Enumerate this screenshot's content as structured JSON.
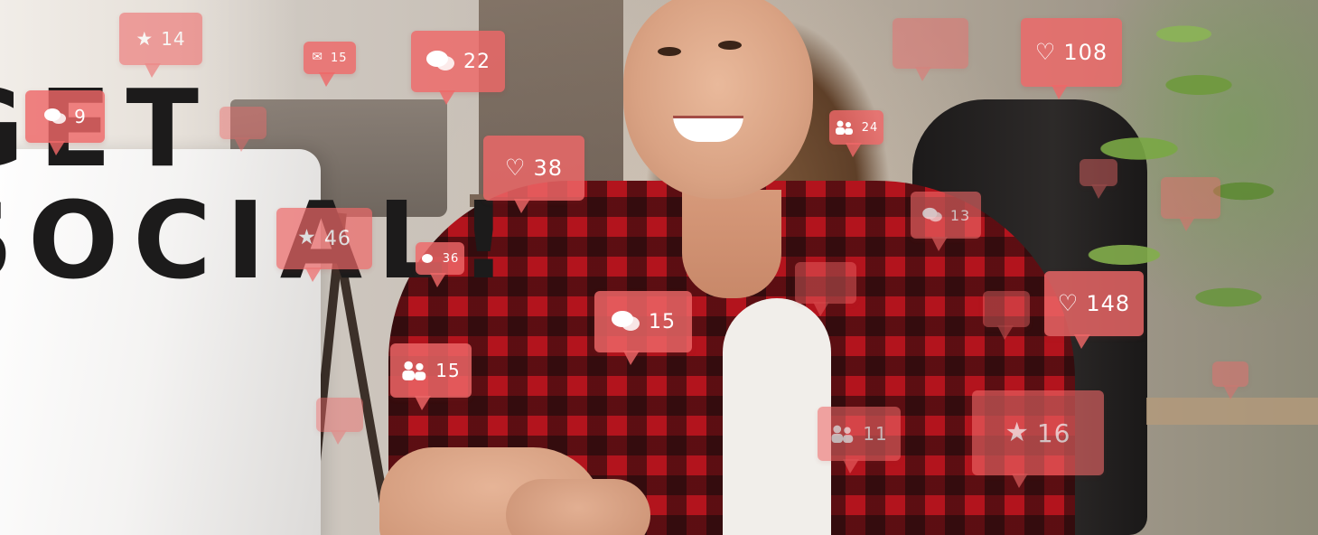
{
  "headline": {
    "line1": "GET",
    "line2": "SOCIAL!"
  },
  "bubbles": [
    {
      "icon": "star-icon",
      "count": "14"
    },
    {
      "icon": "mail-icon",
      "count": "15"
    },
    {
      "icon": "chat-icon",
      "count": "22"
    },
    {
      "icon": "chat-icon",
      "count": "9"
    },
    {
      "icon": "heart-icon",
      "count": "38"
    },
    {
      "icon": "users-icon",
      "count": "24"
    },
    {
      "icon": "heart-icon",
      "count": "108"
    },
    {
      "icon": "star-icon",
      "count": "46"
    },
    {
      "icon": "chat-icon",
      "count": "36"
    },
    {
      "icon": "chat-icon",
      "count": "15"
    },
    {
      "icon": "users-icon",
      "count": "15"
    },
    {
      "icon": "heart-icon",
      "count": "148"
    },
    {
      "icon": "chat-icon",
      "count": "13"
    },
    {
      "icon": "star-icon",
      "count": "16"
    },
    {
      "icon": "users-icon",
      "count": "11"
    }
  ],
  "colors": {
    "bubble": "#ee6868",
    "headline": "#1c1b1b",
    "shirt_red": "#b3141d"
  }
}
